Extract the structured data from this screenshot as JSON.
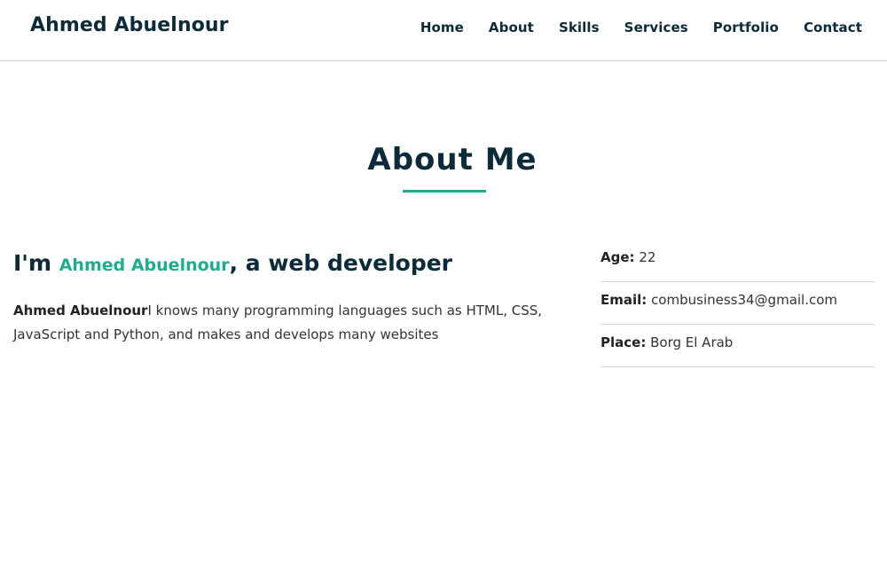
{
  "header": {
    "brand": "Ahmed Abuelnour",
    "nav": [
      "Home",
      "About",
      "Skills",
      "Services",
      "Portfolio",
      "Contact"
    ]
  },
  "about": {
    "title": "About Me",
    "heading_prefix": "I'm ",
    "heading_name": "Ahmed Abuelnour",
    "heading_suffix": ", a web developer",
    "text_bold": "Ahmed Abuelnour",
    "text_body": "I knows many programming languages such as HTML, CSS, JavaScript and Python, and makes and develops many websites",
    "info": [
      {
        "label": "Age:",
        "value": "22"
      },
      {
        "label": "Email:",
        "value": "combusiness34@gmail.com"
      },
      {
        "label": "Place:",
        "value": "Borg El Arab"
      }
    ]
  },
  "colors": {
    "accent": "#1aae8c",
    "dark": "#0b2a3a",
    "text": "#333333"
  }
}
